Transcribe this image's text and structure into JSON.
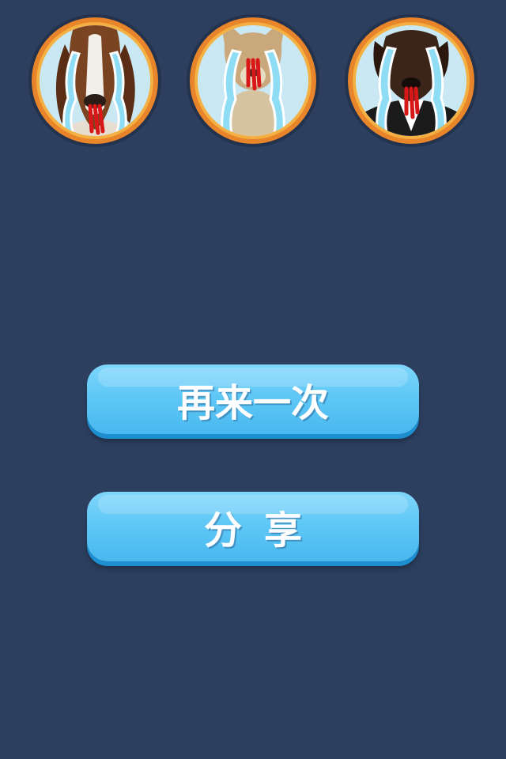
{
  "colors": {
    "background": "#2d3f5f",
    "button": "#5fc8f6",
    "button_shadow": "#1d8fd0",
    "frame_orange": "#e8842a",
    "frame_ring": "#f4b042",
    "tear": "#8fdcf5",
    "blood": "#d81818"
  },
  "avatars": [
    {
      "icon": "crying-basset-hound-avatar"
    },
    {
      "icon": "crying-kangaroo-avatar"
    },
    {
      "icon": "crying-dog-in-suit-avatar"
    }
  ],
  "buttons": {
    "retry_label": "再来一次",
    "share_label": "分享"
  }
}
